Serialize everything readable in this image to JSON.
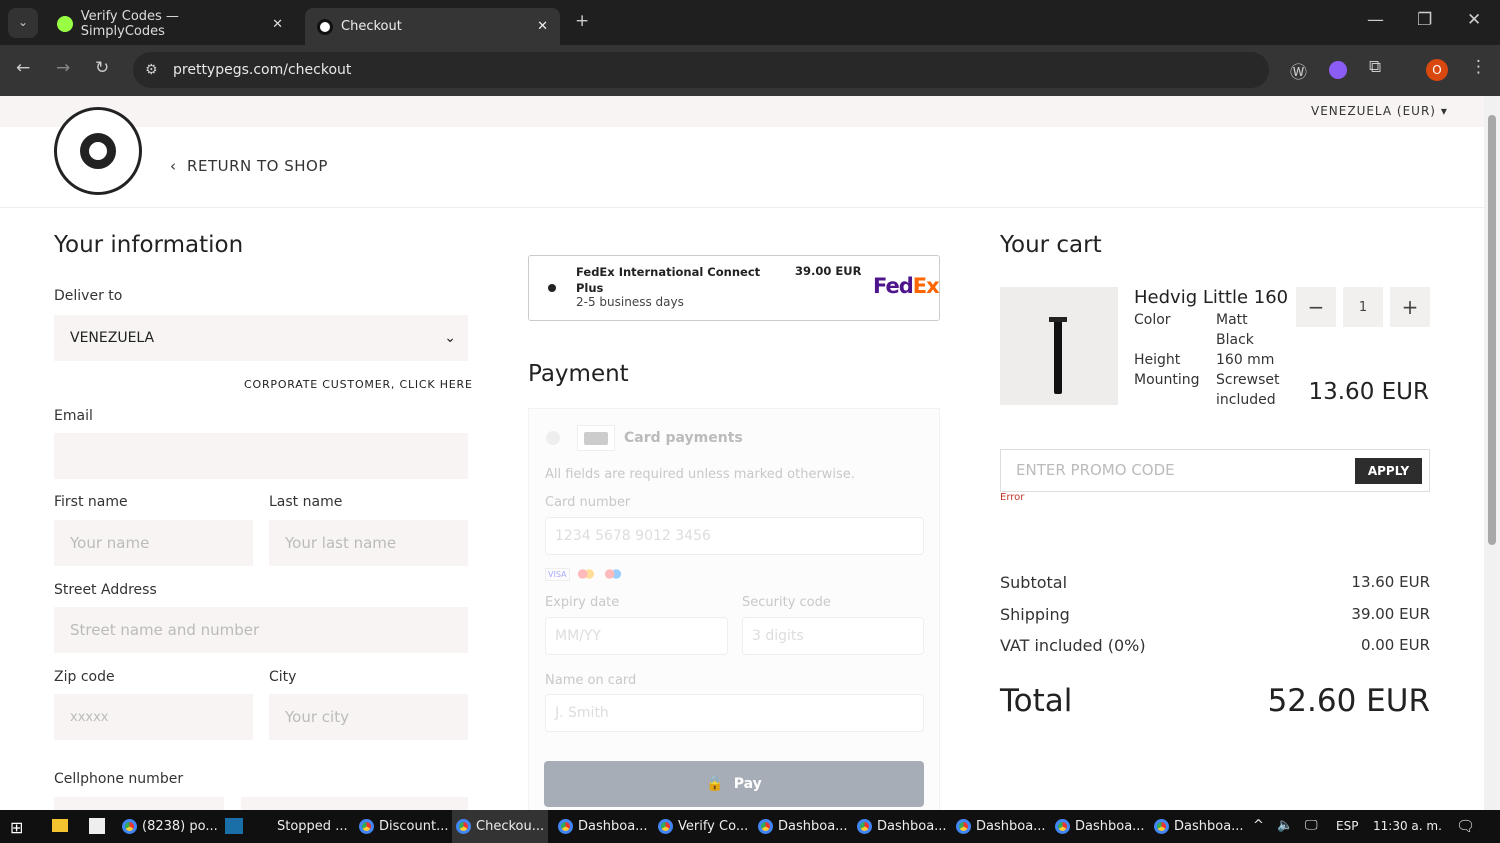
{
  "browser": {
    "tabs": [
      {
        "label": "Verify Codes — SimplyCodes"
      },
      {
        "label": "Checkout"
      }
    ],
    "url": "prettypegs.com/checkout",
    "profile_initial": "O"
  },
  "header": {
    "currency": "VENEZUELA (EUR)",
    "return": "RETURN TO SHOP",
    "logo_text": "PRETTYPEGS LEGS&PARTS"
  },
  "info": {
    "title": "Your information",
    "deliver_label": "Deliver to",
    "country": "VENEZUELA",
    "corporate": "CORPORATE CUSTOMER, CLICK HERE",
    "email_label": "Email",
    "first_label": "First name",
    "first_ph": "Your name",
    "last_label": "Last name",
    "last_ph": "Your last name",
    "street_label": "Street Address",
    "street_ph": "Street name and number",
    "zip_label": "Zip code",
    "zip_ph": "xxxxx",
    "city_label": "City",
    "city_ph": "Your city",
    "phone_label": "Cellphone number"
  },
  "shipping": {
    "name": "FedEx International Connect Plus",
    "time": "2-5 business days",
    "price": "39.00 EUR",
    "logo": "FedEx"
  },
  "payment": {
    "title": "Payment",
    "method": "Card payments",
    "note": "All fields are required unless marked otherwise.",
    "card_label": "Card number",
    "card_ph": "1234 5678 9012 3456",
    "brands": [
      "VISA",
      "Mastercard",
      "Maestro"
    ],
    "expiry_label": "Expiry date",
    "expiry_ph": "MM/YY",
    "cvc_label": "Security code",
    "cvc_ph": "3 digits",
    "name_label": "Name on card",
    "name_ph": "J. Smith",
    "pay": "Pay"
  },
  "cart": {
    "title": "Your cart",
    "item": {
      "name": "Hedvig Little 160",
      "attrs": [
        {
          "k": "Color",
          "v": "Matt Black"
        },
        {
          "k": "Height",
          "v": "160 mm"
        },
        {
          "k": "Mounting",
          "v": "Screwset included"
        }
      ],
      "qty": "1",
      "price": "13.60 EUR"
    },
    "promo_ph": "ENTER PROMO CODE",
    "apply": "APPLY",
    "error": "Error",
    "subtotal_label": "Subtotal",
    "subtotal": "13.60 EUR",
    "shipping_label": "Shipping",
    "shipping": "39.00 EUR",
    "vat_label": "VAT included (0%)",
    "vat": "0.00 EUR",
    "total_label": "Total",
    "total": "52.60 EUR"
  },
  "taskbar": {
    "items": [
      "(8238) po...",
      "Stopped ...",
      "Discount...",
      "Checkou...",
      "Dashboa...",
      "Verify Co...",
      "Dashboa...",
      "Dashboa...",
      "Dashboa...",
      "Dashboa...",
      "Dashboa..."
    ],
    "lang": "ESP",
    "time": "11:30 a. m."
  }
}
